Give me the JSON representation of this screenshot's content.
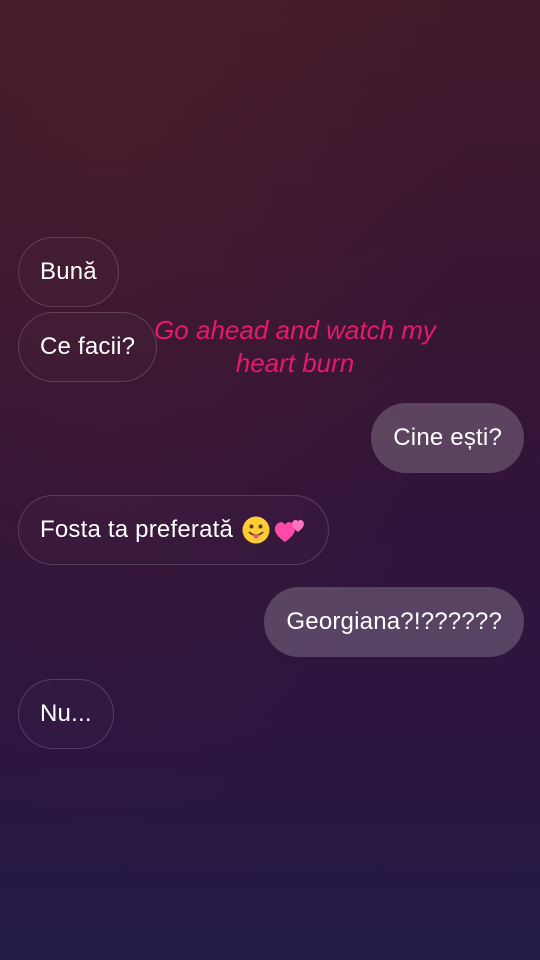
{
  "conversation": {
    "messages": [
      {
        "side": "incoming",
        "text": "Bună"
      },
      {
        "side": "incoming",
        "text": "Ce facii?"
      },
      {
        "side": "outgoing",
        "text": "Cine ești?"
      },
      {
        "side": "incoming",
        "text": "Fosta ta preferată"
      },
      {
        "side": "outgoing",
        "text": "Georgiana?!??????"
      },
      {
        "side": "incoming",
        "text": "Nu..."
      }
    ],
    "message4_emojis": [
      "tongue-face-emoji",
      "two-hearts-emoji"
    ]
  },
  "overlay": {
    "caption_line1": "Go ahead and watch my",
    "caption_line2": "heart burn",
    "color": "#e6196e"
  },
  "colors": {
    "background_top": "#42192a",
    "background_bottom": "#231a47",
    "outgoing_bubble": "rgba(255,255,255,0.20)"
  }
}
